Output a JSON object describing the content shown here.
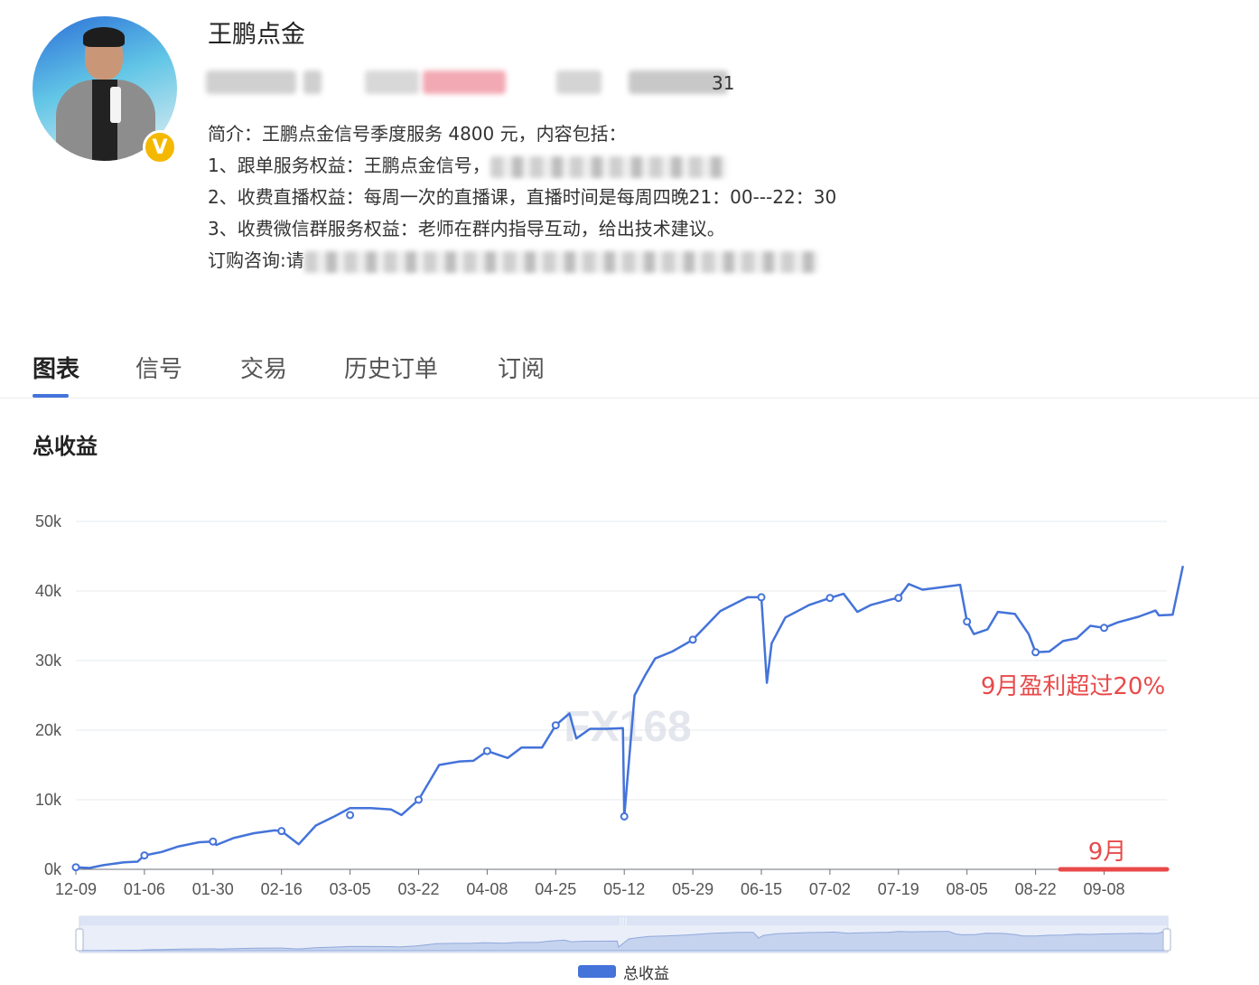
{
  "profile": {
    "name": "王鹏点金",
    "id_tail": "31",
    "description_lines": [
      "简介：王鹏点金信号季度服务 4800 元，内容包括：",
      "1、跟单服务权益：王鹏点金信号，",
      "2、收费直播权益：每周一次的直播课，直播时间是每周四晚21：00---22：30",
      "3、收费微信群服务权益：老师在群内指导互动，给出技术建议。",
      "订购咨询:请"
    ]
  },
  "tabs": [
    "图表",
    "信号",
    "交易",
    "历史订单",
    "订阅"
  ],
  "active_tab": "图表",
  "section_title": "总收益",
  "annotations": {
    "september_profit": "9月盈利超过20%",
    "september_label": "9月"
  },
  "watermark": "FX168",
  "colors": {
    "line": "#4473d9",
    "accent": "#f5b800",
    "annotation": "#e84a4a"
  },
  "chart_data": {
    "type": "line",
    "title": "总收益",
    "ylim": [
      0,
      50000
    ],
    "y_ticks": [
      "0k",
      "10k",
      "20k",
      "30k",
      "40k",
      "50k"
    ],
    "x_ticks": [
      "12-09",
      "01-06",
      "01-30",
      "02-16",
      "03-05",
      "03-22",
      "04-08",
      "04-25",
      "05-12",
      "05-29",
      "06-15",
      "07-02",
      "07-19",
      "08-05",
      "08-22",
      "09-08"
    ],
    "grid": true,
    "legend_position": "bottom",
    "series": [
      {
        "name": "总收益",
        "points": [
          [
            0,
            300
          ],
          [
            0.2,
            200
          ],
          [
            0.4,
            600
          ],
          [
            0.7,
            1000
          ],
          [
            0.9,
            1100
          ],
          [
            1.0,
            2000
          ],
          [
            1.25,
            2500
          ],
          [
            1.5,
            3300
          ],
          [
            1.8,
            3900
          ],
          [
            2.0,
            4000
          ],
          [
            2.05,
            3500
          ],
          [
            2.3,
            4500
          ],
          [
            2.6,
            5200
          ],
          [
            2.9,
            5600
          ],
          [
            3.0,
            5500
          ],
          [
            3.25,
            3600
          ],
          [
            3.5,
            6300
          ],
          [
            3.75,
            7500
          ],
          [
            4.0,
            8800
          ],
          [
            4.3,
            8800
          ],
          [
            4.6,
            8600
          ],
          [
            4.75,
            7800
          ],
          [
            5.0,
            10000
          ],
          [
            5.3,
            15000
          ],
          [
            5.6,
            15500
          ],
          [
            5.8,
            15600
          ],
          [
            6.0,
            17000
          ],
          [
            6.3,
            16000
          ],
          [
            6.5,
            17500
          ],
          [
            6.8,
            17500
          ],
          [
            7.0,
            20700
          ],
          [
            7.2,
            22400
          ],
          [
            7.3,
            18800
          ],
          [
            7.5,
            20200
          ],
          [
            7.75,
            20200
          ],
          [
            7.98,
            20300
          ],
          [
            8.0,
            7600
          ],
          [
            8.15,
            25000
          ],
          [
            8.3,
            27800
          ],
          [
            8.45,
            30300
          ],
          [
            8.7,
            31300
          ],
          [
            9.0,
            33000
          ],
          [
            9.4,
            37100
          ],
          [
            9.8,
            39100
          ],
          [
            10.0,
            39100
          ],
          [
            10.08,
            26800
          ],
          [
            10.15,
            32500
          ],
          [
            10.35,
            36200
          ],
          [
            10.7,
            38000
          ],
          [
            11.0,
            39000
          ],
          [
            11.2,
            39600
          ],
          [
            11.4,
            37000
          ],
          [
            11.6,
            38000
          ],
          [
            11.9,
            38800
          ],
          [
            12.0,
            39000
          ],
          [
            12.15,
            41000
          ],
          [
            12.35,
            40200
          ],
          [
            12.6,
            40500
          ],
          [
            12.9,
            40900
          ],
          [
            13.0,
            35600
          ],
          [
            13.1,
            33800
          ],
          [
            13.3,
            34500
          ],
          [
            13.45,
            37000
          ],
          [
            13.7,
            36700
          ],
          [
            13.9,
            33800
          ],
          [
            14.0,
            31200
          ],
          [
            14.2,
            31300
          ],
          [
            14.4,
            32800
          ],
          [
            14.6,
            33200
          ],
          [
            14.8,
            35000
          ],
          [
            15.0,
            34700
          ],
          [
            15.2,
            35500
          ],
          [
            15.5,
            36300
          ],
          [
            15.75,
            37200
          ],
          [
            15.8,
            36500
          ],
          [
            16.0,
            36600
          ],
          [
            16.15,
            43600
          ]
        ],
        "markers": [
          [
            0,
            300
          ],
          [
            1.0,
            2000
          ],
          [
            2.0,
            4000
          ],
          [
            3.0,
            5500
          ],
          [
            4.0,
            7800
          ],
          [
            5.0,
            10000
          ],
          [
            6.0,
            17000
          ],
          [
            7.0,
            20700
          ],
          [
            8.0,
            7600
          ],
          [
            9.0,
            33000
          ],
          [
            10.0,
            39100
          ],
          [
            11.0,
            39000
          ],
          [
            12.0,
            39000
          ],
          [
            13.0,
            35600
          ],
          [
            14.0,
            31200
          ],
          [
            15.0,
            34700
          ]
        ]
      }
    ]
  }
}
